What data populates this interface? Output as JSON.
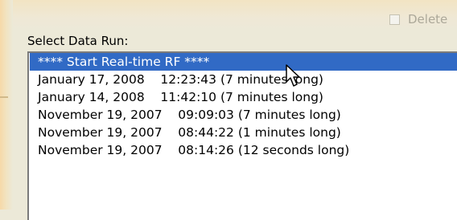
{
  "delete_option": {
    "label": "Delete",
    "checked": false,
    "enabled": false
  },
  "run_selector": {
    "label": "Select Data Run:",
    "items": [
      {
        "text": "**** Start Real-time RF ****",
        "selected": true
      },
      {
        "text": "January 17, 2008    12:23:43 (7 minutes long)",
        "selected": false
      },
      {
        "text": "January 14, 2008    11:42:10 (7 minutes long)",
        "selected": false
      },
      {
        "text": "November 19, 2007    09:09:03 (7 minutes long)",
        "selected": false
      },
      {
        "text": "November 19, 2007    08:44:22 (1 minutes long)",
        "selected": false
      },
      {
        "text": "November 19, 2007    08:14:26 (12 seconds long)",
        "selected": false
      }
    ]
  },
  "colors": {
    "selection": "#316ac5",
    "window_bg": "#ece9d8",
    "disabled_text": "#aca899"
  },
  "icons": {
    "pointer": "arrow-cursor-icon"
  }
}
